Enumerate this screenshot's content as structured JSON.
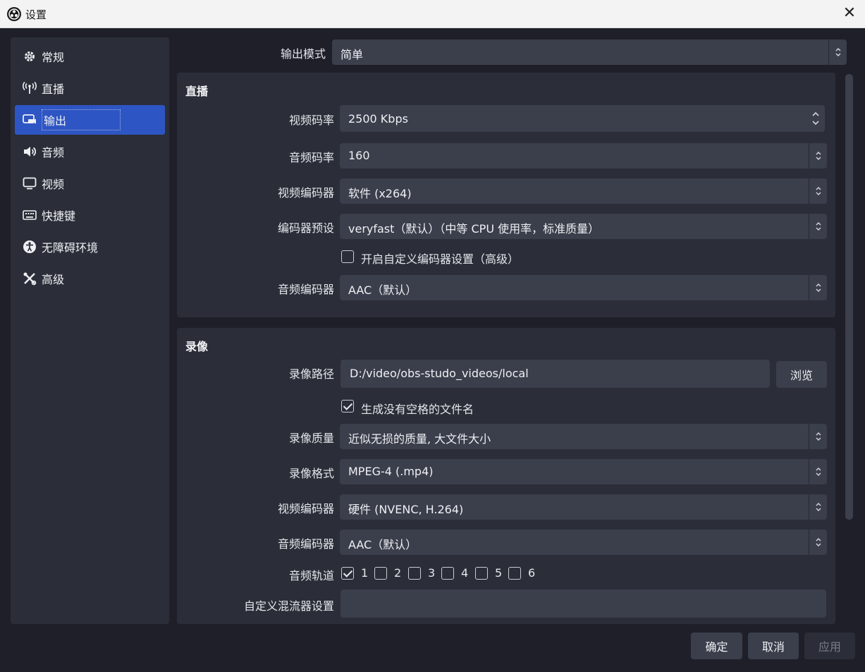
{
  "window": {
    "title": "设置"
  },
  "sidebar": {
    "items": [
      {
        "label": "常规",
        "icon": "gear-icon"
      },
      {
        "label": "直播",
        "icon": "antenna-icon"
      },
      {
        "label": "输出",
        "icon": "output-icon"
      },
      {
        "label": "音频",
        "icon": "speaker-icon"
      },
      {
        "label": "视频",
        "icon": "monitor-icon"
      },
      {
        "label": "快捷键",
        "icon": "keyboard-icon"
      },
      {
        "label": "无障碍环境",
        "icon": "accessibility-icon"
      },
      {
        "label": "高级",
        "icon": "tools-icon"
      }
    ]
  },
  "output_mode": {
    "label": "输出模式",
    "value": "简单"
  },
  "streaming": {
    "title": "直播",
    "video_bitrate": {
      "label": "视频码率",
      "value": "2500 Kbps"
    },
    "audio_bitrate": {
      "label": "音频码率",
      "value": "160"
    },
    "video_encoder": {
      "label": "视频编码器",
      "value": "软件 (x264)"
    },
    "encoder_preset": {
      "label": "编码器预设",
      "value": "veryfast（默认）（中等 CPU 使用率，标准质量）"
    },
    "custom_encoder": {
      "label": "开启自定义编码器设置（高级）",
      "checked": false
    },
    "audio_encoder": {
      "label": "音频编码器",
      "value": "AAC（默认）"
    }
  },
  "recording": {
    "title": "录像",
    "path": {
      "label": "录像路径",
      "value": "D:/video/obs-studo_videos/local"
    },
    "browse_label": "浏览",
    "no_space": {
      "label": "生成没有空格的文件名",
      "checked": true
    },
    "quality": {
      "label": "录像质量",
      "value": "近似无损的质量, 大文件大小"
    },
    "format": {
      "label": "录像格式",
      "value": "MPEG-4 (.mp4)"
    },
    "video_encoder": {
      "label": "视频编码器",
      "value": "硬件 (NVENC, H.264)"
    },
    "audio_encoder": {
      "label": "音频编码器",
      "value": "AAC（默认）"
    },
    "tracks": {
      "label": "音频轨道",
      "items": [
        {
          "label": "1",
          "checked": true
        },
        {
          "label": "2",
          "checked": false
        },
        {
          "label": "3",
          "checked": false
        },
        {
          "label": "4",
          "checked": false
        },
        {
          "label": "5",
          "checked": false
        },
        {
          "label": "6",
          "checked": false
        }
      ]
    },
    "muxer": {
      "label": "自定义混流器设置",
      "value": ""
    }
  },
  "footer": {
    "ok": "确定",
    "cancel": "取消",
    "apply": "应用"
  },
  "colors": {
    "accent": "#2e55c4",
    "panel": "#2b2e38",
    "background": "#1e1f29",
    "control": "#3b3e4b"
  }
}
